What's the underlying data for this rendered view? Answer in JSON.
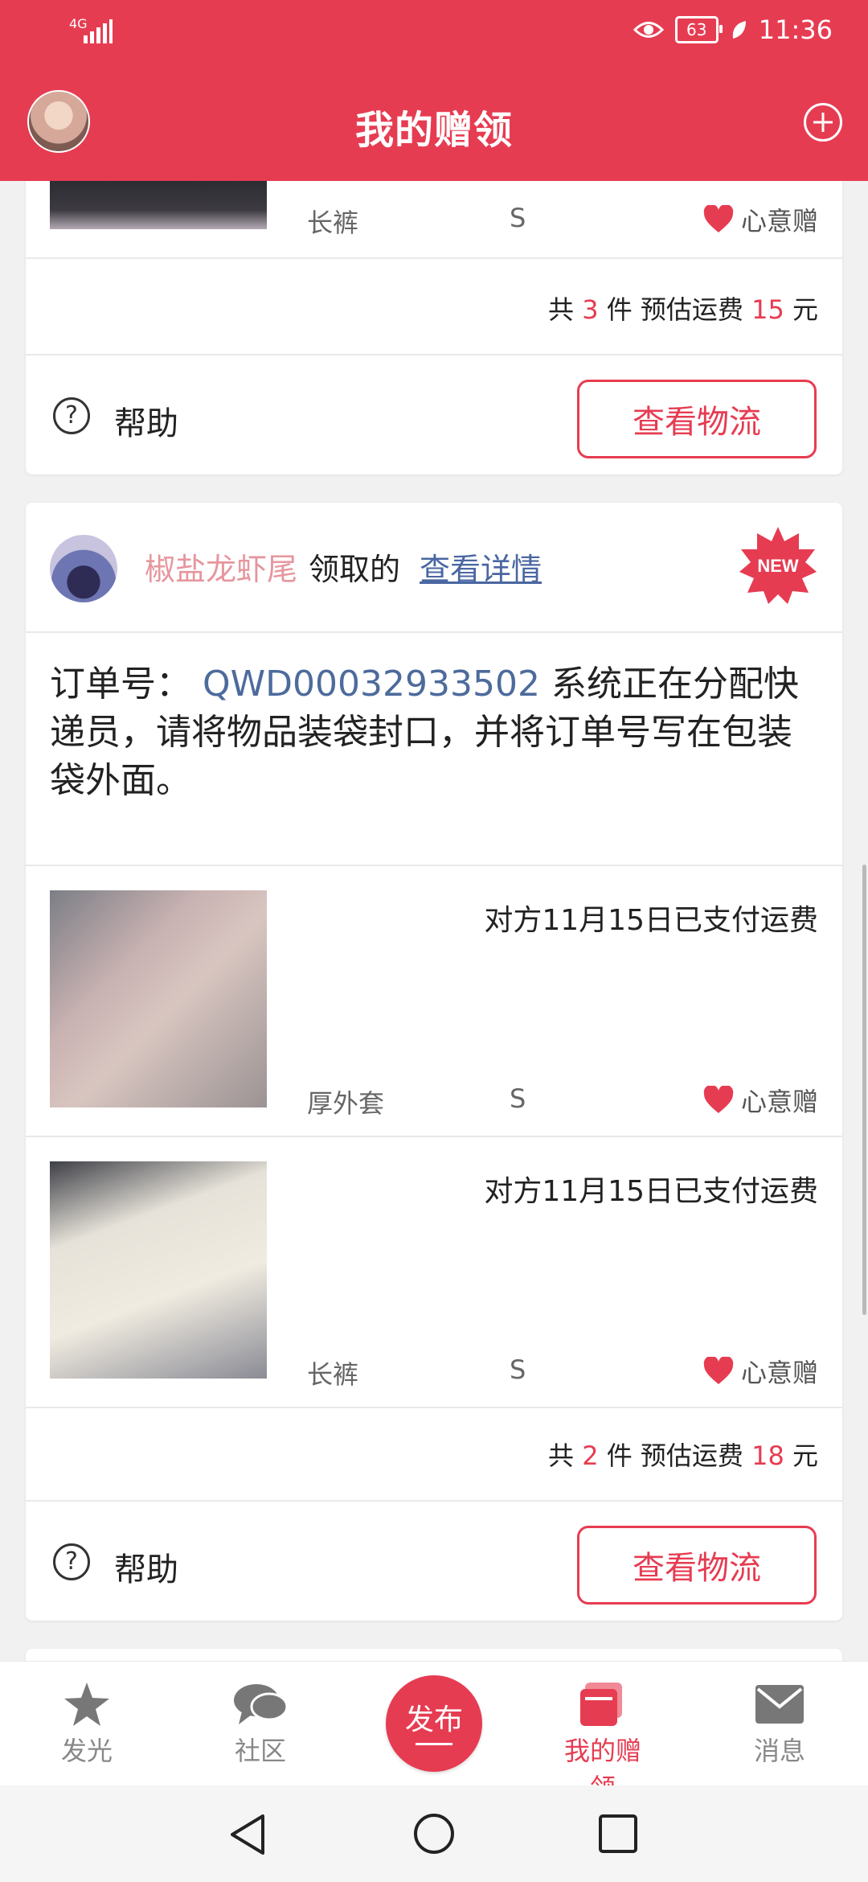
{
  "status": {
    "network": "4G",
    "battery": "63",
    "time": "11:36"
  },
  "header": {
    "title": "我的赠领"
  },
  "card1": {
    "item": {
      "name": "长裤",
      "size": "S",
      "tag": "心意赠"
    },
    "totals": {
      "prefix": "共",
      "count": "3",
      "unit": "件 预估运费",
      "fee": "15",
      "currency": "元"
    },
    "help_label": "帮助",
    "track_button": "查看物流"
  },
  "card2": {
    "username": "椒盐龙虾尾",
    "claimed_text": "领取的",
    "detail_link": "查看详情",
    "badge": "NEW",
    "order_label": "订单号：",
    "order_no": "QWD00032933502",
    "order_msg": "系统正在分配快递员，请将物品装袋封口，并将订单号写在包装袋外面。",
    "items": [
      {
        "paid": "对方11月15日已支付运费",
        "name": "厚外套",
        "size": "S",
        "tag": "心意赠"
      },
      {
        "paid": "对方11月15日已支付运费",
        "name": "长裤",
        "size": "S",
        "tag": "心意赠"
      }
    ],
    "totals": {
      "prefix": "共",
      "count": "2",
      "unit": "件 预估运费",
      "fee": "18",
      "currency": "元"
    },
    "help_label": "帮助",
    "track_button": "查看物流"
  },
  "nav": {
    "items": [
      {
        "label": "发光",
        "icon": "star-icon"
      },
      {
        "label": "社区",
        "icon": "chat-icon"
      },
      {
        "label": "发布",
        "icon": "publish-icon"
      },
      {
        "label": "我的赠领",
        "icon": "gift-icon"
      },
      {
        "label": "消息",
        "icon": "mail-icon"
      }
    ]
  },
  "colors": {
    "brand": "#e63c52",
    "link": "#4a67a2",
    "username": "#e6969e"
  }
}
